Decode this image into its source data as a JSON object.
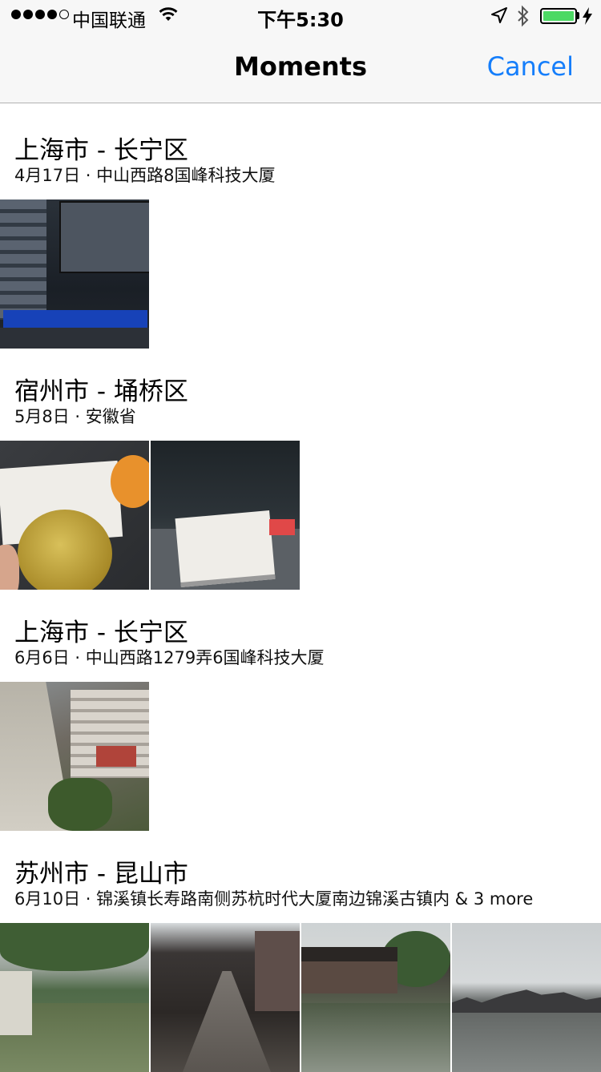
{
  "status_bar": {
    "carrier": "中国联通",
    "time": "下午5:30",
    "signal_bars_filled": 4,
    "signal_bars_total": 5,
    "battery_level": 1.0,
    "icons": [
      "wifi-icon",
      "location-arrow-icon",
      "bluetooth-icon",
      "battery-icon",
      "charging-bolt-icon"
    ]
  },
  "nav": {
    "title": "Moments",
    "cancel_label": "Cancel"
  },
  "colors": {
    "accent": "#157efb",
    "battery_fill": "#4cd964",
    "bar_background": "#f7f7f7"
  },
  "moments": [
    {
      "title": "上海市 - 长宁区",
      "subtitle": "4月17日 · 中山西路8国峰科技大厦",
      "photos": [
        "monitor-screen-photo"
      ]
    },
    {
      "title": "宿州市 - 埇桥区",
      "subtitle": "5月8日 · 安徽省",
      "photos": [
        "apple-and-book-photo",
        "book-on-tray-photo"
      ]
    },
    {
      "title": "上海市 - 长宁区",
      "subtitle": "6月6日 · 中山西路1279弄6国峰科技大厦",
      "photos": [
        "rooftop-street-photo"
      ]
    },
    {
      "title": "苏州市 - 昆山市",
      "subtitle": "6月10日 · 锦溪镇长寿路南侧苏杭时代大厦南边锦溪古镇内 & 3 more",
      "photos": [
        "canal-photo-1",
        "canal-photo-2",
        "canal-photo-3",
        "canal-photo-4"
      ]
    }
  ]
}
